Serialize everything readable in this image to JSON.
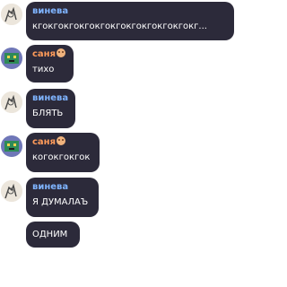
{
  "colors": {
    "bubble": "#2c2a3a",
    "vineva": "#7fb4ff",
    "sanya": "#ff9b5a",
    "text": "#ffffff"
  },
  "messages": [
    {
      "author": "винева",
      "author_color": "#7fb4ff",
      "text": "кгокгокгокгокгокгокгокгокгокгокг...",
      "avatar": "sketch-avatar-icon",
      "badge": false
    },
    {
      "author": "саня",
      "author_color": "#ff9b5a",
      "text": "тихо",
      "avatar": "pixel-avatar-icon",
      "badge": true
    },
    {
      "author": "винева",
      "author_color": "#7fb4ff",
      "text": "БЛЯТЬ",
      "avatar": "sketch-avatar-icon",
      "badge": false
    },
    {
      "author": "саня",
      "author_color": "#ff9b5a",
      "text": "когокгокгок",
      "avatar": "pixel-avatar-icon",
      "badge": true
    },
    {
      "author": "винева",
      "author_color": "#7fb4ff",
      "text": "Я ДУМАЛАЪ",
      "avatar": "sketch-avatar-icon",
      "badge": false
    },
    {
      "author": "",
      "author_color": "",
      "text": "ОДНИМ",
      "avatar": "",
      "badge": false
    }
  ]
}
